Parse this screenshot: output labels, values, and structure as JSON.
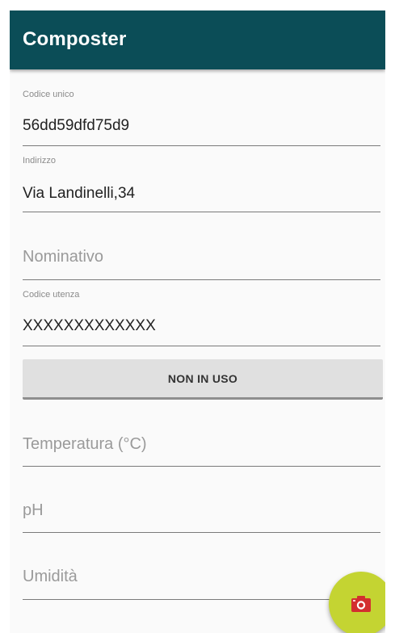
{
  "appbar": {
    "title": "Composter"
  },
  "fields": {
    "codice_unico": {
      "label": "Codice unico",
      "value": "56dd59dfd75d9"
    },
    "indirizzo": {
      "label": "Indirizzo",
      "value": "Via Landinelli,34"
    },
    "nominativo": {
      "placeholder": "Nominativo"
    },
    "codice_utenza": {
      "label": "Codice utenza",
      "value": "XXXXXXXXXXXXX"
    },
    "temperatura": {
      "placeholder": "Temperatura (°C)"
    },
    "ph": {
      "placeholder": "pH"
    },
    "umidita": {
      "placeholder": "Umidità"
    }
  },
  "status_button": {
    "label": "NON IN USO"
  },
  "fab": {
    "icon": "camera-icon",
    "color": "#c4d432",
    "icon_color": "#d32f2f"
  },
  "colors": {
    "appbar": "#0b4d57",
    "background": "#fafafa"
  }
}
